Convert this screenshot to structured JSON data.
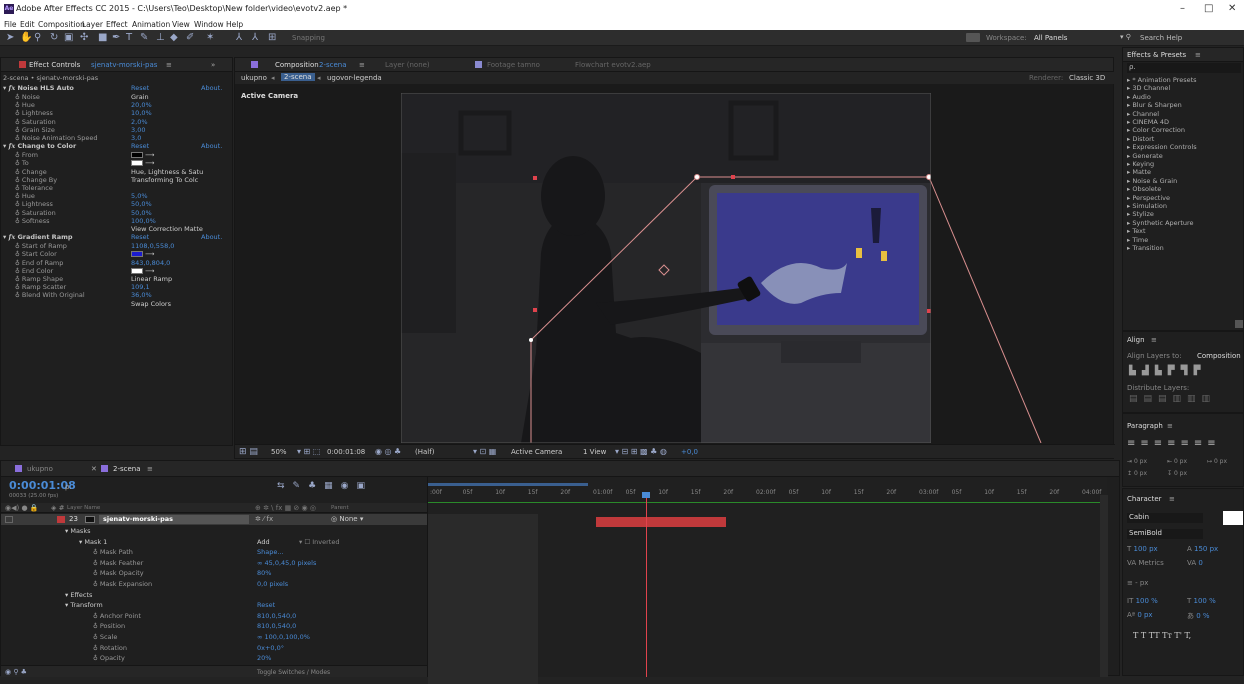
{
  "window": {
    "title": "Adobe After Effects CC 2015 - C:\\Users\\Teo\\Desktop\\New folder\\video\\evotv2.aep *",
    "app_icon": "Ae",
    "min": "–",
    "max": "□",
    "close": "✕"
  },
  "menu": [
    "File",
    "Edit",
    "Composition",
    "Layer",
    "Effect",
    "Animation",
    "View",
    "Window",
    "Help"
  ],
  "toolbar": {
    "snapping": "Snapping",
    "workspace_label": "Workspace:",
    "workspace_value": "All Panels",
    "search_placeholder": "Search Help"
  },
  "effect_controls": {
    "tab_label": "Effect Controls",
    "tab_layer": "sjenatv-morski-pas",
    "tab_menu": "≡",
    "subtitle": "2-scena • sjenatv-morski-pas",
    "effects": [
      {
        "name": "Noise HLS Auto",
        "reset": "Reset",
        "about": "About.",
        "props": [
          [
            "Noise",
            "Grain"
          ],
          [
            "Hue",
            "20,0%"
          ],
          [
            "Lightness",
            "10,0%"
          ],
          [
            "Saturation",
            "2,0%"
          ],
          [
            "Grain Size",
            "3,00"
          ],
          [
            "Noise Animation Speed",
            "3,0"
          ]
        ]
      },
      {
        "name": "Change to Color",
        "reset": "Reset",
        "about": "About.",
        "props": [
          [
            "From",
            ""
          ],
          [
            "To",
            ""
          ],
          [
            "Change",
            "Hue, Lightness & Satu"
          ],
          [
            "Change By",
            "Transforming To Colc"
          ],
          [
            "Tolerance",
            ""
          ],
          [
            "Hue",
            "5,0%"
          ],
          [
            "Lightness",
            "50,0%"
          ],
          [
            "Saturation",
            "50,0%"
          ],
          [
            "Softness",
            "100,0%"
          ],
          [
            "",
            "View Correction Matte"
          ]
        ]
      },
      {
        "name": "Gradient Ramp",
        "reset": "Reset",
        "about": "About.",
        "props": [
          [
            "Start of Ramp",
            "1108,0,558,0"
          ],
          [
            "Start Color",
            ""
          ],
          [
            "End of Ramp",
            "843,0,804,0"
          ],
          [
            "End Color",
            ""
          ],
          [
            "Ramp Shape",
            "Linear Ramp"
          ],
          [
            "Ramp Scatter",
            "109,1"
          ],
          [
            "Blend With Original",
            "36,0%"
          ],
          [
            "",
            "Swap Colors"
          ]
        ]
      }
    ]
  },
  "composition": {
    "tab_label": "Composition",
    "tab_name": "2-scena",
    "tab_menu": "≡",
    "layer_tab": "Layer (none)",
    "footage_tab": "Footage tamno",
    "flowchart_tab": "Flowchart evotv2.aep",
    "breadcrumbs": [
      "ukupno",
      "2-scena",
      "ugovor-legenda"
    ],
    "renderer_label": "Renderer:",
    "renderer_value": "Classic 3D",
    "active_camera": "Active Camera",
    "footer": {
      "zoom": "50%",
      "timecode": "0:00:01:08",
      "resolution": "(Half)",
      "view": "Active Camera",
      "views": "1 View",
      "exposure": "+0,0"
    }
  },
  "effects_presets": {
    "title": "Effects & Presets",
    "menu": "≡",
    "search": "ρ.",
    "items": [
      "* Animation Presets",
      "3D Channel",
      "Audio",
      "Blur & Sharpen",
      "Channel",
      "CINEMA 4D",
      "Color Correction",
      "Distort",
      "Expression Controls",
      "Generate",
      "Keying",
      "Matte",
      "Noise & Grain",
      "Obsolete",
      "Perspective",
      "Simulation",
      "Stylize",
      "Synthetic Aperture",
      "Text",
      "Time",
      "Transition"
    ]
  },
  "align": {
    "title": "Align",
    "menu": "≡",
    "align_to_label": "Align Layers to:",
    "align_to_value": "Composition",
    "distribute": "Distribute Layers:"
  },
  "paragraph": {
    "title": "Paragraph",
    "menu": "≡",
    "indent1": "0 px",
    "indent2": "0 px",
    "indent3": "0 px",
    "space1": "0 px",
    "space2": "0 px"
  },
  "character": {
    "title": "Character",
    "menu": "≡",
    "font": "Cabin",
    "style": "SemiBold",
    "size": "100 px",
    "leading": "150 px",
    "kerning": "Metrics",
    "tracking": "0",
    "stroke": "- px",
    "vscale": "100 %",
    "hscale": "100 %",
    "baseline": "0 px",
    "tsume": "0 %",
    "styles": "T  T  TT  Tт  T'  T,"
  },
  "timeline": {
    "tabs": [
      "ukupno",
      "2-scena"
    ],
    "tab_menu": "≡",
    "timecode": "0:00:01:08",
    "frames": "00033 (25.00 fps)",
    "col_layer": "Layer Name",
    "col_parent": "Parent",
    "ticks": [
      ":00f",
      "05f",
      "10f",
      "15f",
      "20f",
      "01:00f",
      "05f",
      "10f",
      "15f",
      "20f",
      "02:00f",
      "05f",
      "10f",
      "15f",
      "20f",
      "03:00f",
      "05f",
      "10f",
      "15f",
      "20f",
      "04:00f"
    ],
    "layer": {
      "num": "23",
      "name": "sjenatv-morski-pas",
      "parent": "None"
    },
    "rows": [
      {
        "indent": 1,
        "label": "Masks",
        "value": "",
        "grp": true
      },
      {
        "indent": 2,
        "label": "Mask 1",
        "value": "Add",
        "extra": "Inverted",
        "grp": true
      },
      {
        "indent": 3,
        "label": "Mask Path",
        "value": "Shape..."
      },
      {
        "indent": 3,
        "label": "Mask Feather",
        "value": "∞ 45,0,45,0 pixels"
      },
      {
        "indent": 3,
        "label": "Mask Opacity",
        "value": "80%"
      },
      {
        "indent": 3,
        "label": "Mask Expansion",
        "value": "0,0 pixels"
      },
      {
        "indent": 1,
        "label": "Effects",
        "value": "",
        "grp": true
      },
      {
        "indent": 1,
        "label": "Transform",
        "value": "Reset",
        "grp": true
      },
      {
        "indent": 3,
        "label": "Anchor Point",
        "value": "810,0,540,0"
      },
      {
        "indent": 3,
        "label": "Position",
        "value": "810,0,540,0"
      },
      {
        "indent": 3,
        "label": "Scale",
        "value": "∞ 100,0,100,0%"
      },
      {
        "indent": 3,
        "label": "Rotation",
        "value": "0x+0,0°"
      },
      {
        "indent": 3,
        "label": "Opacity",
        "value": "20%"
      }
    ],
    "toggle": "Toggle Switches / Modes"
  },
  "colors": {
    "accent": "#4a8bd6",
    "label_red": "#c0393b",
    "playhead": "#e0434d",
    "tv_screen": "#3a3a8c"
  }
}
